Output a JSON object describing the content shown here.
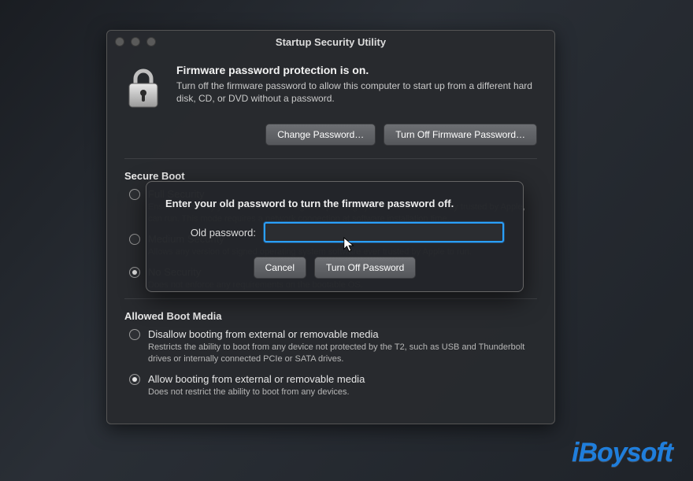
{
  "window": {
    "title": "Startup Security Utility",
    "hero": {
      "heading": "Firmware password protection is on.",
      "subtext": "Turn off the firmware password to allow this computer to start up from a different hard disk, CD, or DVD without a password."
    },
    "buttons": {
      "change_password": "Change Password…",
      "turn_off_firmware": "Turn Off Firmware Password…"
    },
    "secure_boot": {
      "title": "Secure Boot",
      "options": [
        {
          "label": "Full Security",
          "desc": "Ensures that only your current OS, or signed operating system software currently trusted by Apple, can run. This mode requires a network connection at software installation time.",
          "selected": false
        },
        {
          "label": "Medium Security",
          "desc": "Allows any version of signed operating system software ever trusted by Apple to run.",
          "selected": false
        },
        {
          "label": "No Security",
          "desc": "Does not enforce any requirements on the bootable OS.",
          "selected": true
        }
      ]
    },
    "allowed_boot": {
      "title": "Allowed Boot Media",
      "options": [
        {
          "label": "Disallow booting from external or removable media",
          "desc": "Restricts the ability to boot from any device not protected by the T2, such as USB and Thunderbolt drives or internally connected PCIe or SATA drives.",
          "selected": false
        },
        {
          "label": "Allow booting from external or removable media",
          "desc": "Does not restrict the ability to boot from any devices.",
          "selected": true
        }
      ]
    }
  },
  "sheet": {
    "prompt": "Enter your old password to turn the firmware password off.",
    "field_label": "Old password:",
    "value": "",
    "cancel": "Cancel",
    "confirm": "Turn Off Password"
  },
  "watermark": "iBoysoft"
}
